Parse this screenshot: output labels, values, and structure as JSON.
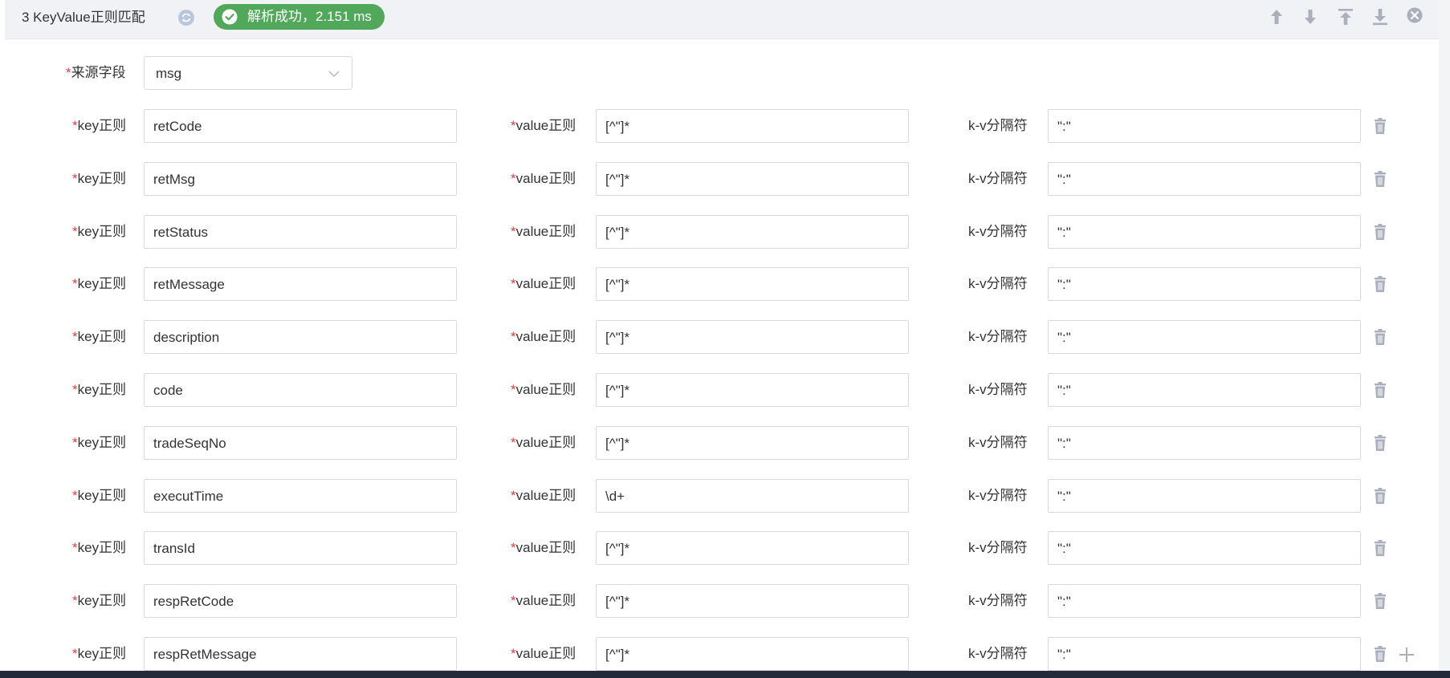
{
  "header": {
    "title": "3 KeyValue正则匹配",
    "status": "解析成功，2.151 ms",
    "tools": [
      "arrow-up-icon",
      "arrow-down-icon",
      "move-top-icon",
      "move-bottom-icon",
      "close-circle-icon"
    ]
  },
  "source": {
    "required_mark": "*",
    "label": "来源字段",
    "value": "msg"
  },
  "labels": {
    "required_mark": "*",
    "key": "key正则",
    "value": "value正则",
    "separator": "k-v分隔符"
  },
  "rows": [
    {
      "key": "retCode",
      "value": "[^\"]*",
      "separator": "\":\""
    },
    {
      "key": "retMsg",
      "value": "[^\"]*",
      "separator": "\":\""
    },
    {
      "key": "retStatus",
      "value": "[^\"]*",
      "separator": "\":\""
    },
    {
      "key": "retMessage",
      "value": "[^\"]*",
      "separator": "\":\""
    },
    {
      "key": "description",
      "value": "[^\"]*",
      "separator": "\":\""
    },
    {
      "key": "code",
      "value": "[^\"]*",
      "separator": "\":\""
    },
    {
      "key": "tradeSeqNo",
      "value": "[^\"]*",
      "separator": "\":\""
    },
    {
      "key": "executTime",
      "value": "\\d+",
      "separator": "\":\""
    },
    {
      "key": "transId",
      "value": "[^\"]*",
      "separator": "\":\""
    },
    {
      "key": "respRetCode",
      "value": "[^\"]*",
      "separator": "\":\""
    },
    {
      "key": "respRetMessage",
      "value": "[^\"]*",
      "separator": "\":\""
    }
  ],
  "colors": {
    "success": "#52a85a",
    "required": "#e5393b",
    "header_bg": "#f0f2f5",
    "icon_gray": "#a9b0bc"
  }
}
